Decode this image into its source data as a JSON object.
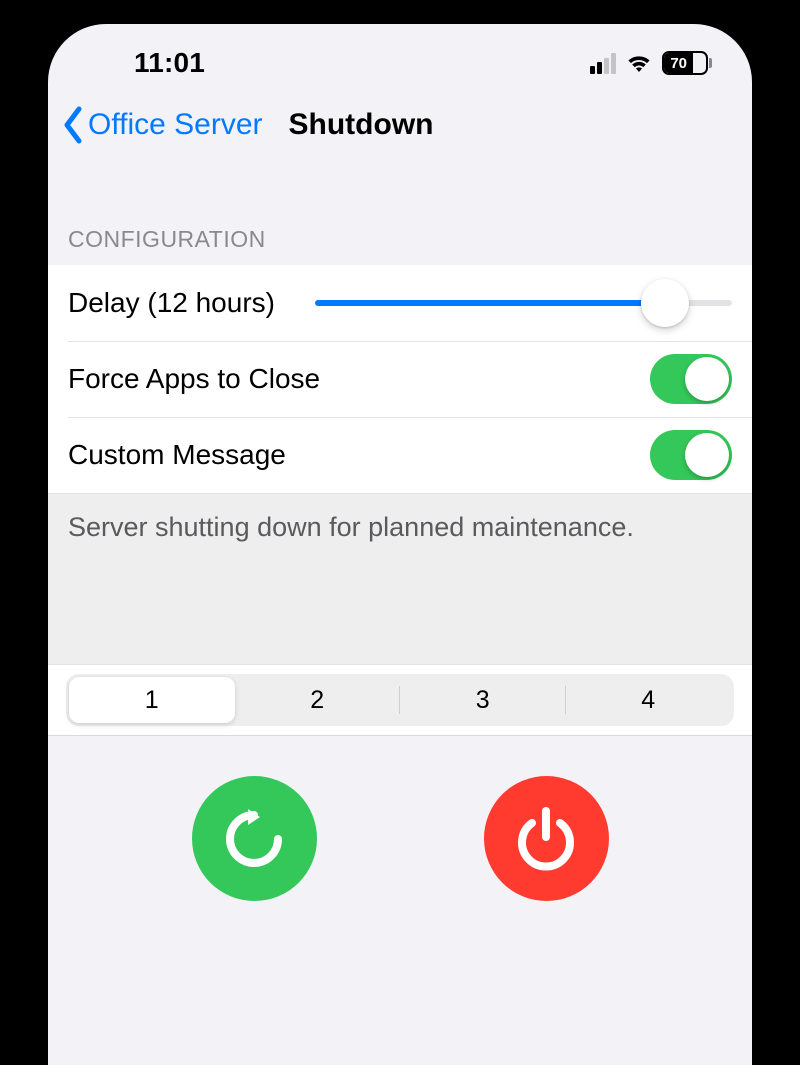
{
  "statusBar": {
    "time": "11:01",
    "battery": "70"
  },
  "nav": {
    "back": "Office Server",
    "title": "Shutdown"
  },
  "section": {
    "header": "CONFIGURATION"
  },
  "config": {
    "delayLabel": "Delay (12 hours)",
    "delaySliderPercent": 84,
    "forceCloseLabel": "Force Apps to Close",
    "forceCloseOn": true,
    "customMessageLabel": "Custom Message",
    "customMessageOn": true,
    "messageText": "Server shutting down for planned maintenance."
  },
  "segments": [
    "1",
    "2",
    "3",
    "4"
  ],
  "selectedSegment": "1",
  "icons": {
    "restart": "restart-icon",
    "shutdown": "power-icon"
  },
  "colors": {
    "accent": "#007aff",
    "green": "#34c759",
    "red": "#ff3b30"
  }
}
